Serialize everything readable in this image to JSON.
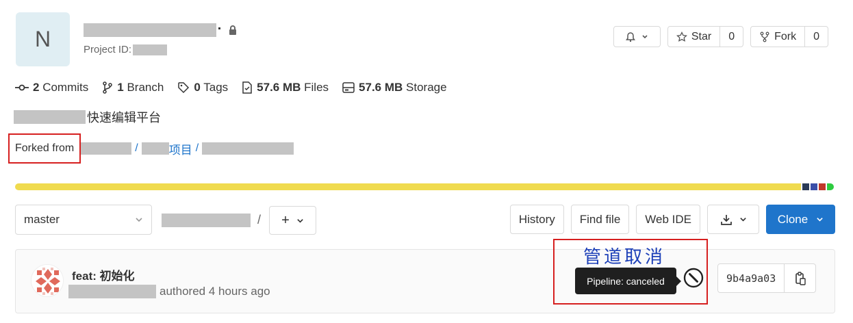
{
  "project": {
    "avatar_letter": "N",
    "project_id_label": "Project ID:"
  },
  "actions": {
    "star_label": "Star",
    "star_count": "0",
    "fork_label": "Fork",
    "fork_count": "0"
  },
  "stats": {
    "commits_count": "2",
    "commits_label": "Commits",
    "branch_count": "1",
    "branch_label": "Branch",
    "tags_count": "0",
    "tags_label": "Tags",
    "files_size": "57.6 MB",
    "files_label": "Files",
    "storage_size": "57.6 MB",
    "storage_label": "Storage"
  },
  "description": "快速编辑平台",
  "forked": {
    "label": "Forked from",
    "sep1": "/",
    "project_link": "项目",
    "sep2": "/"
  },
  "toolbar": {
    "branch": "master",
    "path_sep": "/",
    "add_label": "+",
    "history": "History",
    "find_file": "Find file",
    "web_ide": "Web IDE",
    "clone": "Clone"
  },
  "commit": {
    "title": "feat: 初始化",
    "authored": "authored 4 hours ago",
    "sha": "9b4a9a03"
  },
  "annotation": {
    "text": "管道取消",
    "tooltip": "Pipeline: canceled"
  },
  "colors": {
    "primary": "#1f75cb",
    "annotation_red": "#d61f1f",
    "lang_main": "#f0db4f",
    "lang_segments": [
      "#2b3b57",
      "#3b4fa8",
      "#c0392b",
      "#2ecc40"
    ]
  },
  "icons": [
    "lock-icon",
    "bell-icon",
    "star-icon",
    "fork-icon",
    "commit-icon",
    "branch-icon",
    "tag-icon",
    "file-icon",
    "storage-icon",
    "download-icon",
    "chevron-down-icon",
    "canceled-icon",
    "copy-icon"
  ]
}
